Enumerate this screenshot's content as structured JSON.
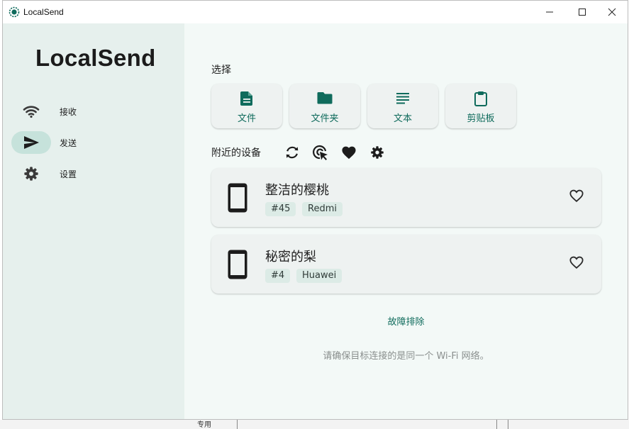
{
  "window": {
    "title": "LocalSend",
    "controls": [
      "minimize-icon",
      "maximize-icon",
      "close-icon"
    ]
  },
  "sidebar": {
    "brand": "LocalSend",
    "items": [
      {
        "label": "接收",
        "icon": "wifi-icon",
        "active": false
      },
      {
        "label": "发送",
        "icon": "send-icon",
        "active": true
      },
      {
        "label": "设置",
        "icon": "gear-icon",
        "active": false
      }
    ]
  },
  "main": {
    "select_label": "选择",
    "pick_buttons": [
      {
        "label": "文件",
        "icon": "file-icon"
      },
      {
        "label": "文件夹",
        "icon": "folder-icon"
      },
      {
        "label": "文本",
        "icon": "text-icon"
      },
      {
        "label": "剪贴板",
        "icon": "clipboard-icon"
      }
    ],
    "nearby_label": "附近的设备",
    "nearby_actions": [
      "refresh-icon",
      "target-cursor-icon",
      "heart-icon",
      "gear-icon"
    ],
    "devices": [
      {
        "name": "整洁的樱桃",
        "tags": [
          "#45",
          "Redmi"
        ],
        "icon": "phone-icon"
      },
      {
        "name": "秘密的梨",
        "tags": [
          "#4",
          "Huawei"
        ],
        "icon": "phone-icon"
      }
    ],
    "troubleshoot": "故障排除",
    "hint": "请确保目标连接的是同一个 Wi-Fi 网络。"
  },
  "background": {
    "bottom_text": "专用"
  },
  "colors": {
    "accent": "#0f6b5c",
    "sidebar_bg": "#e6f0ed",
    "main_bg": "#f3f9f7",
    "active_pill": "#c6e2db",
    "tag_bg": "#dcebe6"
  }
}
